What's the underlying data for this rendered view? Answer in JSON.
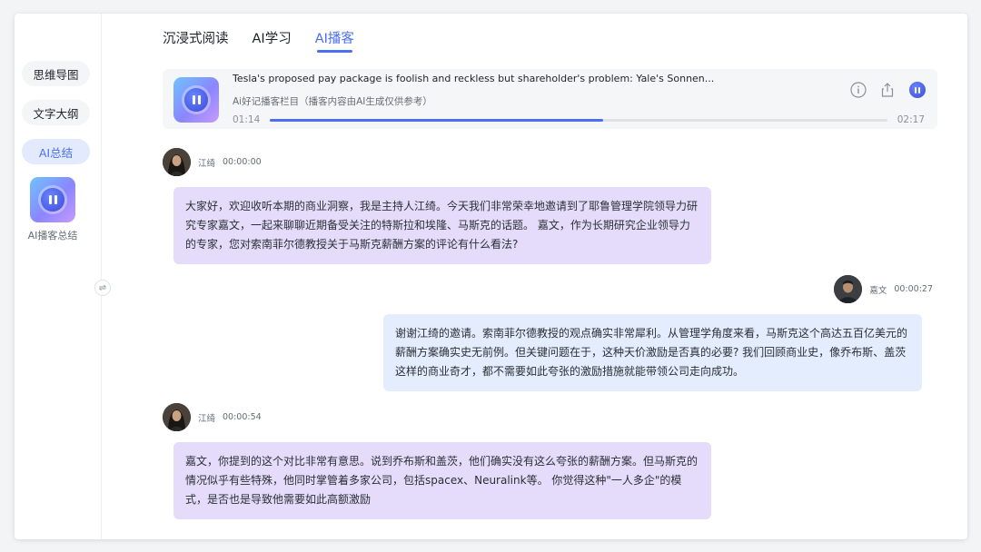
{
  "sidebar": {
    "items": [
      {
        "label": "思维导图",
        "active": false
      },
      {
        "label": "文字大纲",
        "active": false
      },
      {
        "label": "AI总结",
        "active": true
      }
    ],
    "podcast_label": "AI播客总结",
    "collapse_icon": "⇌"
  },
  "tabs": [
    {
      "label": "沉浸式阅读",
      "active": false
    },
    {
      "label": "AI学习",
      "active": false
    },
    {
      "label": "AI播客",
      "active": true
    }
  ],
  "player": {
    "title": "Tesla's proposed pay package is foolish and reckless but shareholder's problem: Yale's Sonnen...",
    "subtitle": "Ai好记播客栏目（播客内容由AI生成仅供参考）",
    "current_time": "01:14",
    "total_time": "02:17",
    "progress": 0.54,
    "icons": [
      "info-icon",
      "share-icon",
      "pause-icon"
    ]
  },
  "messages": [
    {
      "speaker": "江绮",
      "time": "00:00:00",
      "side": "left",
      "text": "大家好，欢迎收听本期的商业洞察，我是主持人江绮。今天我们非常荣幸地邀请到了耶鲁管理学院领导力研究专家嘉文，一起来聊聊近期备受关注的特斯拉和埃隆、马斯克的话题。 嘉文，作为长期研究企业领导力的专家，您对索南菲尔德教授关于马斯克薪酬方案的评论有什么看法?"
    },
    {
      "speaker": "嘉文",
      "time": "00:00:27",
      "side": "right",
      "text": "谢谢江绮的邀请。索南菲尔德教授的观点确实非常犀利。从管理学角度来看，马斯克这个高达五百亿美元的薪酬方案确实史无前例。但关键问题在于，这种天价激励是否真的必要? 我们回顾商业史，像乔布斯、盖茨这样的商业奇才，都不需要如此夸张的激励措施就能带领公司走向成功。"
    },
    {
      "speaker": "江绮",
      "time": "00:00:54",
      "side": "left",
      "text": "嘉文，你提到的这个对比非常有意思。说到乔布斯和盖茨，他们确实没有这么夸张的薪酬方案。但马斯克的情况似乎有些特殊，他同时掌管着多家公司，包括spacex、Neuralink等。 你觉得这种\"一人多企\"的模式，是否也是导致他需要如此高额激励"
    }
  ],
  "colors": {
    "accent": "#4a6ff0",
    "left_bubble": "#e4dcfa",
    "right_bubble": "#e3edfd"
  }
}
